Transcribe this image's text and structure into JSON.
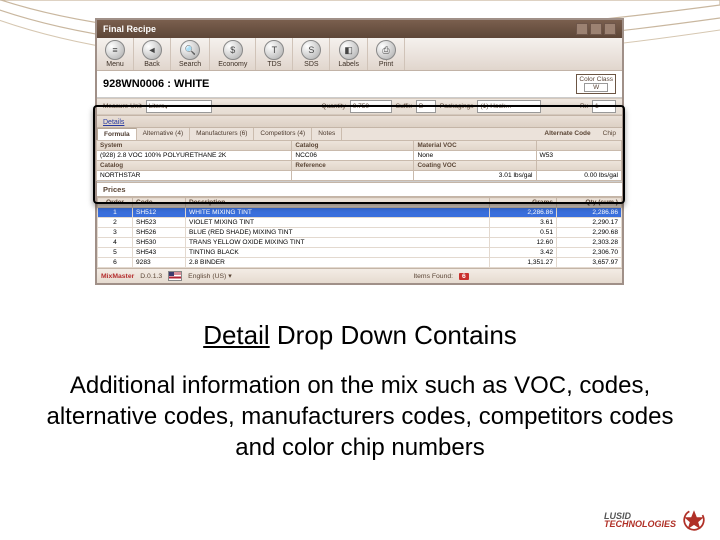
{
  "slide": {
    "title_u": "Detail",
    "title_rest": " Drop Down Contains",
    "body": "Additional information on the mix such as VOC, codes, alternative codes, manufacturers codes, competitors codes and color chip numbers",
    "logo_top": "LUSID",
    "logo_bot": "TECHNOLOGIES"
  },
  "window": {
    "title": "Final Recipe"
  },
  "toolbar": [
    {
      "name": "menu-button",
      "glyph": "≡",
      "label": "Menu"
    },
    {
      "name": "back-button",
      "glyph": "◄",
      "label": "Back"
    },
    {
      "name": "search-button",
      "glyph": "🔍",
      "label": "Search"
    },
    {
      "name": "economy-button",
      "glyph": "$",
      "label": "Economy"
    },
    {
      "name": "tds-button",
      "glyph": "T",
      "label": "TDS"
    },
    {
      "name": "sds-button",
      "glyph": "S",
      "label": "SDS"
    },
    {
      "name": "labels-button",
      "glyph": "◧",
      "label": "Labels"
    },
    {
      "name": "print-button",
      "glyph": "⎙",
      "label": "Print"
    }
  ],
  "header": {
    "code": "928WN0006",
    "sep": " : ",
    "name": "WHITE",
    "color_class_label": "Color Class",
    "color_class_value": "W"
  },
  "measure_row": {
    "measure_label": "Measure Unit",
    "measure_value": "Liters",
    "qty_label": "Quantity",
    "qty_value": "0.750",
    "suffix_label": "Suffix",
    "suffix_value": "B",
    "packaging_label": "Packagings",
    "packaging_value": "(1) Hook…",
    "rtx_label": "Rx",
    "rtx_value": "1"
  },
  "details_link": "Details",
  "tabs": {
    "items": [
      "Formula",
      "Alternative (4)",
      "Manufacturers (6)",
      "Competitors (4)",
      "Notes"
    ],
    "alt_label": "Alternate Code",
    "chip_label": "Chip"
  },
  "detail": {
    "system_label": "System",
    "system_value": "(928) 2.8 VOC 100% POLYURETHANE 2K",
    "catalog_label": "Catalog",
    "catalog_value": "NCC06",
    "matvoc_label": "Material VOC",
    "matvoc_value": "None",
    "chip_value": "W53",
    "catalog2_label": "Catalog",
    "catalog2_value": "NORTHSTAR",
    "reference_label": "Reference",
    "reference_value": "",
    "coatvoc_label": "Coating VOC",
    "coatvoc_value": "3.01 lbs/gal",
    "mat2_value": "0.00 lbs/gal"
  },
  "prices_label": "Prices",
  "columns": {
    "order": "Order",
    "code": "Code",
    "description": "Description",
    "grams": "Grams",
    "qty": "Qty (cum.)"
  },
  "rows": [
    {
      "order": "1",
      "code": "SH512",
      "desc": "WHITE MIXING TINT",
      "grams": "2,286.86",
      "qty": "2,286.86",
      "sel": true
    },
    {
      "order": "2",
      "code": "SH523",
      "desc": "VIOLET MIXING TINT",
      "grams": "3.61",
      "qty": "2,290.17"
    },
    {
      "order": "3",
      "code": "SH526",
      "desc": "BLUE (RED SHADE) MIXING TINT",
      "grams": "0.51",
      "qty": "2,290.68"
    },
    {
      "order": "4",
      "code": "SH530",
      "desc": "TRANS YELLOW OXIDE MIXING TINT",
      "grams": "12.60",
      "qty": "2,303.28"
    },
    {
      "order": "5",
      "code": "SH543",
      "desc": "TINTING BLACK",
      "grams": "3.42",
      "qty": "2,306.70"
    },
    {
      "order": "6",
      "code": "9283",
      "desc": "2.8 BINDER",
      "grams": "1,351.27",
      "qty": "3,657.97"
    }
  ],
  "status": {
    "brand": "MixMaster",
    "version": "D.0.1.3",
    "lang": "English (US)",
    "items_found_label": "Items Found:",
    "items_found": "6"
  }
}
